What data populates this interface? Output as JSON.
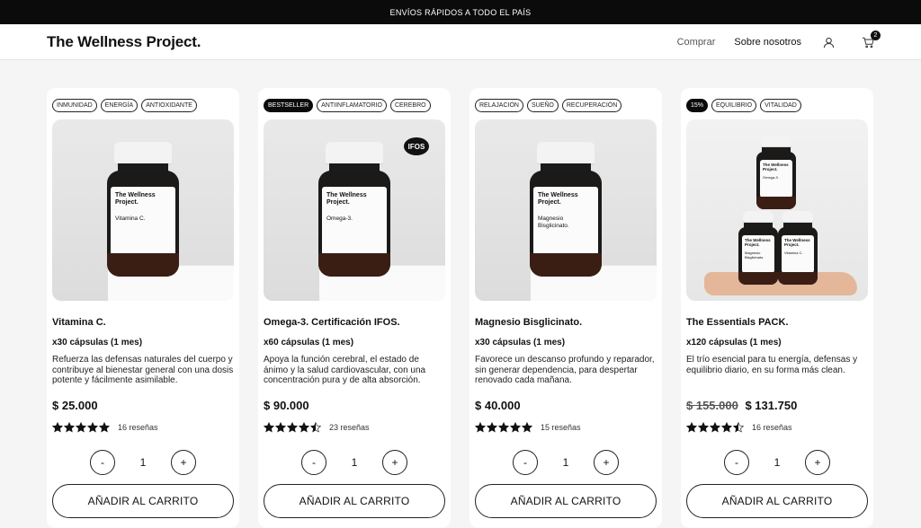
{
  "topbar": {
    "text": "ENVÍOS RÁPIDOS A TODO EL PAÍS"
  },
  "header": {
    "logo": "The Wellness Project.",
    "nav": {
      "buy": "Comprar",
      "about": "Sobre nosotros"
    },
    "cart_count": "2"
  },
  "products": [
    {
      "tags": [
        "INMUNIDAD",
        "ENERGÍA",
        "ANTIOXIDANTE"
      ],
      "bottle_label": "Vitamina C.",
      "name": "Vitamina C.",
      "dose": "x30 cápsulas (1 mes)",
      "description": "Refuerza las defensas naturales del cuerpo y contribuye al bienestar general con una dosis potente y fácilmente asimilable.",
      "price": "$ 25.000",
      "rating": 5,
      "reviews": "16 reseñas",
      "qty": "1",
      "add_label": "AÑADIR AL CARRITO"
    },
    {
      "tags": [
        "BESTSELLER",
        "ANTIINFLAMATORIO",
        "CEREBRO"
      ],
      "bottle_label": "Omega-3.",
      "badge_text": "IFOS",
      "name": "Omega-3. Certificación IFOS.",
      "dose": "x60 cápsulas (1 mes)",
      "description": "Apoya la función cerebral, el estado de ánimo y la salud cardiovascular, con una concentración pura y de alta absorción.",
      "price": "$ 90.000",
      "rating": 4.5,
      "reviews": "23 reseñas",
      "qty": "1",
      "add_label": "AÑADIR AL CARRITO"
    },
    {
      "tags": [
        "RELAJACIÓN",
        "SUEÑO",
        "RECUPERACIÓN"
      ],
      "bottle_label": "Magnesio Bisglicinato.",
      "name": "Magnesio Bisglicinato.",
      "dose": "x30 cápsulas (1 mes)",
      "description": "Favorece un descanso profundo y reparador, sin generar dependencia, para despertar renovado cada mañana.",
      "price": "$ 40.000",
      "rating": 5,
      "reviews": "15 reseñas",
      "qty": "1",
      "add_label": "AÑADIR AL CARRITO"
    },
    {
      "tags": [
        "15%",
        "EQUILIBRIO",
        "VITALIDAD"
      ],
      "name": "The Essentials PACK.",
      "dose": "x120 cápsulas (1 mes)",
      "description": "El trío esencial para tu energía, defensas y equilibrio diario, en su forma más clean.",
      "old_price": "$ 155.000",
      "price": "$ 131.750",
      "rating": 4.5,
      "reviews": "16 reseñas",
      "qty": "1",
      "add_label": "AÑADIR AL CARRITO",
      "pack_labels": [
        "Omega-3.",
        "Magnesio Bisglicinato.",
        "Vitamina C."
      ]
    }
  ],
  "brand_on_bottle": "The Wellness Project.",
  "qty_minus": "-",
  "qty_plus": "+"
}
